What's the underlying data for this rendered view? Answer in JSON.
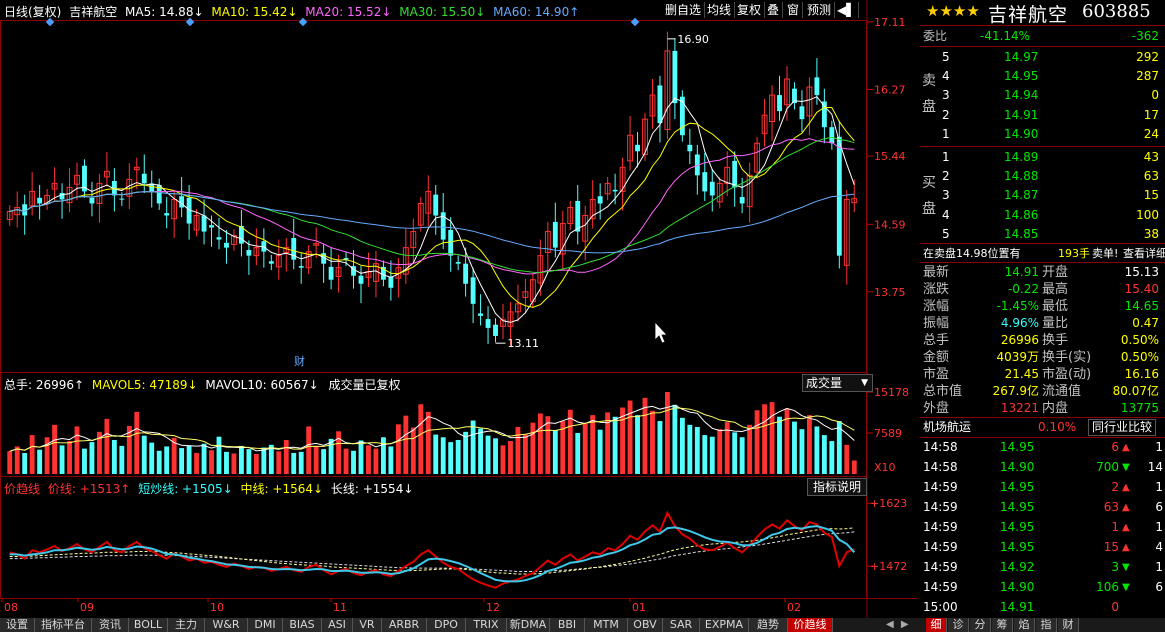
{
  "header": {
    "period": "日线(复权)",
    "stock_name": "吉祥航空",
    "ma5": "MA5: 14.88↓",
    "ma10": "MA10: 15.42↓",
    "ma20": "MA20: 15.52↓",
    "ma30": "MA30: 15.50↓",
    "ma60": "MA60: 14.90↑"
  },
  "toolbar": [
    "删自选",
    "均线",
    "复权",
    "叠",
    "窗",
    "预测",
    "◀▌"
  ],
  "price_axis": [
    "17.11",
    "16.27",
    "15.44",
    "14.59",
    "13.75"
  ],
  "vol_axis": [
    "15178",
    "7589",
    "X10"
  ],
  "ind_axis": [
    "+1623",
    "+1472"
  ],
  "annotations": {
    "high": "16.90",
    "low": "13.11",
    "fin": "财"
  },
  "volume_header": {
    "total": "总手: 26996↑",
    "mavol5": "MAVOL5: 47189↓",
    "mavol10": "MAVOL10: 60567↓",
    "note": "成交量已复权",
    "select": "成交量"
  },
  "indicator_header": {
    "name": "价趋线",
    "price_line": "价线: +1513↑",
    "short_line": "短炒线: +1505↓",
    "mid_line": "中线: +1564↓",
    "long_line": "长线: +1554↓",
    "button": "指标说明"
  },
  "months": [
    "08",
    "09",
    "10",
    "11",
    "12",
    "01",
    "02"
  ],
  "bottom_tabs": [
    "设置",
    "指标平台",
    "资讯",
    "BOLL",
    "主力",
    "W&R",
    "DMI",
    "BIAS",
    "ASI",
    "VR",
    "ARBR",
    "DPO",
    "TRIX",
    "新DMA",
    "BBI",
    "MTM",
    "OBV",
    "SAR",
    "EXPMA",
    "趋势",
    "价趋线"
  ],
  "right_bottom_tabs": [
    "细",
    "诊",
    "分",
    "筹",
    "焰",
    "指",
    "财"
  ],
  "quote": {
    "stars": "★★★★",
    "name": "吉祥航空",
    "code": "603885",
    "wei_label": "委比",
    "wei_pct": "-41.14%",
    "wei_diff": "-362",
    "sell_label": "卖盘",
    "buy_label": "买盘",
    "asks": [
      {
        "lvl": "5",
        "price": "14.97",
        "vol": "292"
      },
      {
        "lvl": "4",
        "price": "14.95",
        "vol": "287"
      },
      {
        "lvl": "3",
        "price": "14.94",
        "vol": "0"
      },
      {
        "lvl": "2",
        "price": "14.91",
        "vol": "17"
      },
      {
        "lvl": "1",
        "price": "14.90",
        "vol": "24"
      }
    ],
    "bids": [
      {
        "lvl": "1",
        "price": "14.89",
        "vol": "43"
      },
      {
        "lvl": "2",
        "price": "14.88",
        "vol": "63"
      },
      {
        "lvl": "3",
        "price": "14.87",
        "vol": "15"
      },
      {
        "lvl": "4",
        "price": "14.86",
        "vol": "100"
      },
      {
        "lvl": "5",
        "price": "14.85",
        "vol": "38"
      }
    ],
    "sell_info": "在卖盘14.98位置有",
    "sell_info_vol": "193手",
    "sell_info_btn": "卖单!",
    "detail_btn": "查看详细",
    "stats": [
      {
        "l1": "最新",
        "v1": "14.91",
        "l2": "开盘",
        "v2": "15.13"
      },
      {
        "l1": "涨跌",
        "v1": "-0.22",
        "l2": "最高",
        "v2": "15.40"
      },
      {
        "l1": "涨幅",
        "v1": "-1.45%",
        "l2": "最低",
        "v2": "14.65"
      },
      {
        "l1": "振幅",
        "v1": "4.96%",
        "l2": "量比",
        "v2": "0.47"
      },
      {
        "l1": "总手",
        "v1": "26996",
        "l2": "换手",
        "v2": "0.50%"
      },
      {
        "l1": "金额",
        "v1": "4039万",
        "l2": "换手(实)",
        "v2": "0.50%"
      },
      {
        "l1": "市盈",
        "v1": "21.45",
        "l2": "市盈(动)",
        "v2": "16.16"
      },
      {
        "l1": "总市值",
        "v1": "267.9亿",
        "l2": "流通值",
        "v2": "80.07亿"
      },
      {
        "l1": "外盘",
        "v1": "13221",
        "l2": "内盘",
        "v2": "13775"
      }
    ],
    "industry": "机场航运",
    "industry_pct": "0.10%",
    "industry_btn": "同行业比较",
    "ticks": [
      {
        "t": "14:58",
        "p": "14.95",
        "v": "6",
        "d": "up",
        "n": "1"
      },
      {
        "t": "14:58",
        "p": "14.90",
        "v": "700",
        "d": "down",
        "n": "14"
      },
      {
        "t": "14:59",
        "p": "14.95",
        "v": "2",
        "d": "up",
        "n": "1"
      },
      {
        "t": "14:59",
        "p": "14.95",
        "v": "63",
        "d": "up",
        "n": "6"
      },
      {
        "t": "14:59",
        "p": "14.95",
        "v": "1",
        "d": "up",
        "n": "1"
      },
      {
        "t": "14:59",
        "p": "14.95",
        "v": "15",
        "d": "up",
        "n": "4"
      },
      {
        "t": "14:59",
        "p": "14.92",
        "v": "3",
        "d": "down",
        "n": "1"
      },
      {
        "t": "14:59",
        "p": "14.90",
        "v": "106",
        "d": "down",
        "n": "6"
      },
      {
        "t": "15:00",
        "p": "14.91",
        "v": "0",
        "d": "none",
        "n": ""
      }
    ]
  },
  "chart_data": {
    "type": "candlestick",
    "price_range": [
      13.0,
      17.11
    ],
    "closes": [
      14.75,
      14.8,
      14.7,
      15.0,
      14.85,
      14.95,
      15.1,
      14.9,
      15.05,
      15.2,
      15.0,
      14.85,
      15.1,
      15.25,
      14.95,
      14.9,
      15.15,
      15.3,
      15.1,
      15.0,
      14.85,
      14.7,
      14.9,
      14.8,
      14.6,
      14.7,
      14.5,
      14.55,
      14.4,
      14.3,
      14.45,
      14.35,
      14.2,
      14.3,
      14.25,
      14.1,
      14.2,
      14.3,
      14.15,
      14.05,
      14.25,
      14.35,
      14.1,
      13.9,
      14.05,
      14.15,
      13.95,
      13.85,
      14.0,
      14.1,
      13.9,
      13.8,
      14.05,
      14.3,
      14.5,
      14.85,
      15.0,
      14.7,
      14.4,
      14.2,
      14.1,
      13.85,
      13.6,
      13.45,
      13.3,
      13.2,
      13.4,
      13.5,
      13.6,
      13.75,
      13.9,
      14.2,
      14.5,
      14.3,
      14.6,
      14.8,
      14.5,
      14.7,
      14.9,
      14.85,
      15.1,
      15.0,
      15.3,
      15.7,
      15.5,
      15.9,
      16.2,
      15.85,
      16.75,
      16.1,
      15.7,
      15.5,
      15.2,
      15.0,
      14.95,
      15.1,
      15.3,
      15.05,
      14.85,
      15.2,
      15.6,
      15.95,
      16.2,
      16.0,
      16.4,
      16.1,
      15.9,
      16.3,
      16.2,
      15.8,
      15.6,
      14.2,
      14.9,
      14.91
    ],
    "vol_range": [
      0,
      15178
    ],
    "volumes": [
      4200,
      5100,
      3900,
      7200,
      4500,
      6800,
      9100,
      5300,
      6100,
      8800,
      4700,
      5900,
      7800,
      10200,
      6300,
      5200,
      8900,
      11500,
      7100,
      5800,
      4300,
      5100,
      6700,
      4800,
      5300,
      3900,
      5600,
      4400,
      6900,
      4100,
      3800,
      5200,
      4600,
      3700,
      4900,
      5400,
      4200,
      6300,
      3900,
      4100,
      8800,
      5200,
      4600,
      6500,
      7900,
      4700,
      4300,
      6200,
      5300,
      4700,
      6800,
      5100,
      9200,
      10800,
      8600,
      12900,
      11500,
      7300,
      6800,
      5900,
      6300,
      7800,
      9900,
      8400,
      7100,
      6600,
      5300,
      6100,
      8700,
      7300,
      9500,
      11200,
      10700,
      8100,
      9800,
      11900,
      7600,
      9300,
      10900,
      8200,
      11400,
      10600,
      12300,
      13600,
      10900,
      14100,
      11700,
      9800,
      15178,
      12800,
      10400,
      9100,
      8700,
      7200,
      6900,
      8300,
      9600,
      7700,
      6800,
      9100,
      11800,
      12900,
      13300,
      10600,
      12100,
      9700,
      8300,
      10900,
      8800,
      7200,
      6100,
      9800,
      5400,
      2500
    ],
    "indicator_range": [
      1400,
      1650
    ],
    "price_line": [
      1505,
      1500,
      1490,
      1510,
      1505,
      1512,
      1520,
      1508,
      1515,
      1525,
      1512,
      1505,
      1518,
      1530,
      1510,
      1505,
      1520,
      1530,
      1515,
      1508,
      1498,
      1490,
      1502,
      1495,
      1485,
      1490,
      1480,
      1482,
      1475,
      1470,
      1478,
      1472,
      1465,
      1470,
      1468,
      1460,
      1465,
      1470,
      1462,
      1458,
      1470,
      1475,
      1462,
      1452,
      1460,
      1465,
      1455,
      1450,
      1458,
      1462,
      1452,
      1448,
      1460,
      1472,
      1482,
      1500,
      1510,
      1495,
      1480,
      1470,
      1465,
      1452,
      1440,
      1432,
      1425,
      1420,
      1430,
      1435,
      1440,
      1448,
      1455,
      1470,
      1485,
      1475,
      1490,
      1500,
      1485,
      1495,
      1505,
      1500,
      1515,
      1510,
      1525,
      1545,
      1535,
      1555,
      1570,
      1555,
      1600,
      1568,
      1548,
      1538,
      1522,
      1512,
      1510,
      1518,
      1528,
      1515,
      1505,
      1522,
      1542,
      1560,
      1572,
      1562,
      1582,
      1568,
      1558,
      1578,
      1572,
      1552,
      1542,
      1472,
      1505,
      1513
    ],
    "short_line": [
      1500,
      1500,
      1497,
      1500,
      1502,
      1505,
      1510,
      1510,
      1512,
      1516,
      1514,
      1511,
      1513,
      1518,
      1515,
      1512,
      1514,
      1519,
      1517,
      1514,
      1508,
      1501,
      1500,
      1497,
      1492,
      1490,
      1486,
      1484,
      1480,
      1476,
      1475,
      1473,
      1470,
      1469,
      1468,
      1465,
      1464,
      1465,
      1464,
      1462,
      1463,
      1465,
      1464,
      1460,
      1460,
      1461,
      1459,
      1456,
      1456,
      1457,
      1456,
      1453,
      1455,
      1460,
      1466,
      1477,
      1488,
      1490,
      1488,
      1484,
      1479,
      1472,
      1464,
      1455,
      1447,
      1439,
      1436,
      1435,
      1435,
      1438,
      1443,
      1450,
      1460,
      1465,
      1472,
      1480,
      1482,
      1486,
      1492,
      1495,
      1501,
      1505,
      1512,
      1522,
      1527,
      1536,
      1547,
      1550,
      1563,
      1565,
      1561,
      1556,
      1549,
      1541,
      1535,
      1531,
      1530,
      1527,
      1522,
      1522,
      1528,
      1537,
      1547,
      1552,
      1561,
      1564,
      1562,
      1566,
      1568,
      1563,
      1557,
      1535,
      1525,
      1505
    ],
    "mid_line": [
      1495,
      1495,
      1496,
      1496,
      1497,
      1498,
      1499,
      1500,
      1501,
      1502,
      1503,
      1503,
      1504,
      1505,
      1505,
      1505,
      1506,
      1507,
      1507,
      1507,
      1506,
      1505,
      1504,
      1503,
      1501,
      1500,
      1498,
      1497,
      1495,
      1493,
      1491,
      1489,
      1487,
      1485,
      1483,
      1481,
      1479,
      1478,
      1476,
      1475,
      1474,
      1473,
      1472,
      1470,
      1469,
      1468,
      1467,
      1466,
      1465,
      1464,
      1463,
      1462,
      1461,
      1461,
      1461,
      1462,
      1463,
      1464,
      1465,
      1465,
      1465,
      1464,
      1462,
      1460,
      1458,
      1456,
      1455,
      1454,
      1453,
      1453,
      1453,
      1454,
      1455,
      1457,
      1459,
      1461,
      1463,
      1465,
      1468,
      1470,
      1473,
      1476,
      1479,
      1483,
      1487,
      1491,
      1496,
      1500,
      1506,
      1511,
      1515,
      1518,
      1521,
      1523,
      1525,
      1526,
      1528,
      1529,
      1530,
      1532,
      1534,
      1537,
      1540,
      1543,
      1547,
      1550,
      1553,
      1556,
      1559,
      1561,
      1562,
      1561,
      1562,
      1564
    ],
    "long_line": [
      1490,
      1490,
      1491,
      1491,
      1492,
      1492,
      1493,
      1493,
      1494,
      1495,
      1495,
      1496,
      1496,
      1497,
      1497,
      1497,
      1498,
      1498,
      1498,
      1498,
      1498,
      1498,
      1497,
      1497,
      1496,
      1495,
      1494,
      1493,
      1492,
      1491,
      1490,
      1489,
      1488,
      1487,
      1486,
      1485,
      1484,
      1483,
      1482,
      1481,
      1480,
      1479,
      1478,
      1477,
      1476,
      1475,
      1474,
      1473,
      1472,
      1471,
      1470,
      1469,
      1468,
      1468,
      1467,
      1467,
      1467,
      1467,
      1467,
      1467,
      1467,
      1466,
      1465,
      1464,
      1463,
      1462,
      1461,
      1460,
      1459,
      1459,
      1459,
      1459,
      1460,
      1461,
      1462,
      1463,
      1465,
      1466,
      1468,
      1469,
      1471,
      1473,
      1475,
      1477,
      1480,
      1483,
      1486,
      1489,
      1493,
      1497,
      1500,
      1503,
      1506,
      1508,
      1510,
      1512,
      1514,
      1516,
      1518,
      1520,
      1522,
      1525,
      1528,
      1531,
      1534,
      1537,
      1540,
      1543,
      1546,
      1548,
      1550,
      1551,
      1552,
      1554
    ]
  }
}
